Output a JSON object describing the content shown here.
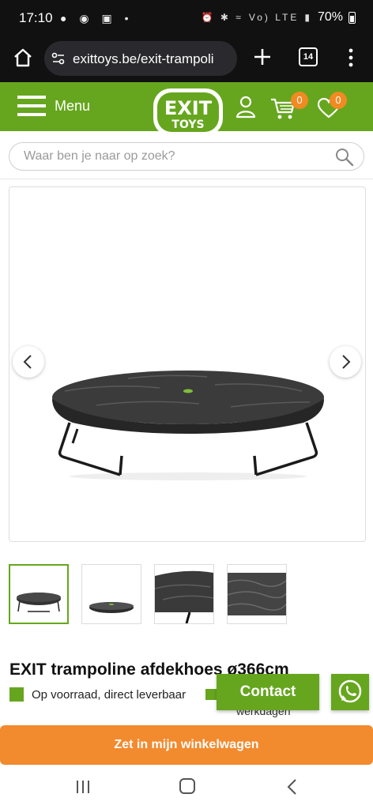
{
  "status_bar": {
    "time": "17:10",
    "notification_icons": [
      "silent-icon",
      "vpn-icon",
      "image-icon",
      "dot-icon"
    ],
    "system_icons": [
      "alarm-icon",
      "bluetooth-icon",
      "wifi-icon",
      "volte-icon",
      "signal-icon"
    ],
    "network": "Vo) LTE",
    "battery": "70%"
  },
  "browser": {
    "url": "exittoys.be/exit-trampoli",
    "tab_count": "14"
  },
  "header": {
    "menu_label": "Menu",
    "logo_line1": "EXIT",
    "logo_line2": "TOYS",
    "cart_count": "0",
    "wishlist_count": "0",
    "brand_color": "#66a61e",
    "accent_color": "#f08a22"
  },
  "search": {
    "placeholder": "Waar ben je naar op zoek?"
  },
  "gallery": {
    "thumbnail_count": 4,
    "active_thumbnail": 1
  },
  "product": {
    "title": "EXIT trampoline afdekhoes ø366cm",
    "stock": "Op voorraad, direct leverbaar",
    "delivery_partial": "werkdagen"
  },
  "actions": {
    "contact": "Contact",
    "add_to_cart": "Zet in mijn winkelwagen",
    "cta_color": "#f28a2e"
  },
  "system_nav": {
    "buttons": [
      "recent-apps",
      "home",
      "back"
    ]
  }
}
